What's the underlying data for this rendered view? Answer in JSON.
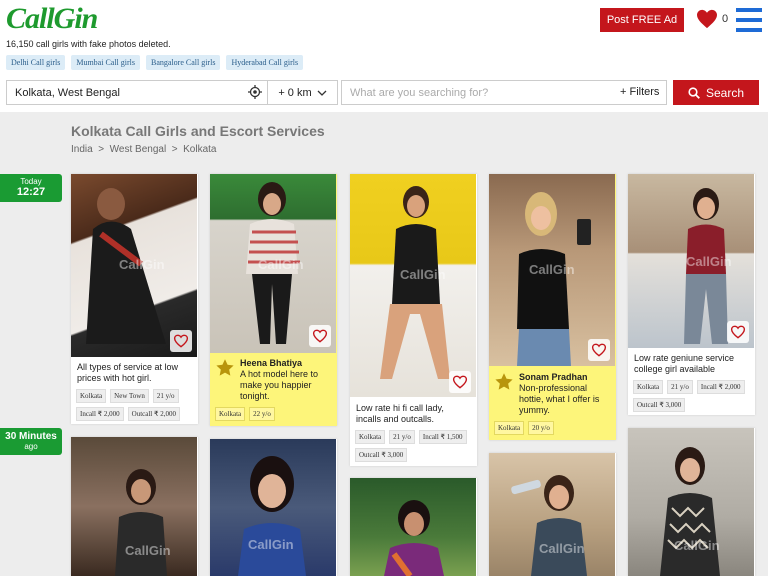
{
  "header": {
    "logo": "CallGin",
    "tagline": "16,150 call girls with fake photos deleted.",
    "chips": [
      "Delhi Call girls",
      "Mumbai Call girls",
      "Bangalore Call girls",
      "Hyderabad Call girls"
    ],
    "post_label": "Post FREE Ad",
    "fav_count": "0",
    "brand_color": "#1e9a2e",
    "accent_color": "#c4161c"
  },
  "search": {
    "location": "Kolkata, West Bengal",
    "radius": "+ 0 km",
    "placeholder": "What are you searching for?",
    "filters_label": "+ Filters",
    "button_label": "Search"
  },
  "page": {
    "title": "Kolkata Call Girls and Escort Services",
    "breadcrumb": [
      "India",
      "West Bengal",
      "Kolkata"
    ]
  },
  "time_groups": [
    {
      "line1": "Today",
      "line2": "12:27"
    },
    {
      "line1": "30 Minutes",
      "line2": "ago"
    }
  ],
  "listings": [
    {
      "featured": false,
      "name": "",
      "text": "All types of service at low prices with hot girl.",
      "tags": [
        "Kolkata",
        "New Town",
        "21 y/o",
        "Incall ₹ 2,000",
        "Outcall ₹ 2,000"
      ]
    },
    {
      "featured": true,
      "name": "Heena Bhatiya",
      "text": "A hot model here to make you happier tonight.",
      "tags": [
        "Kolkata",
        "22 y/o"
      ]
    },
    {
      "featured": false,
      "name": "",
      "text": "Low rate hi fi call lady, incalls and outcalls.",
      "tags": [
        "Kolkata",
        "21 y/o",
        "Incall ₹ 1,500",
        "Outcall ₹ 3,000"
      ]
    },
    {
      "featured": true,
      "name": "Sonam Pradhan",
      "text": "Non-professional hottie, what I offer is yummy.",
      "tags": [
        "Kolkata",
        "20 y/o"
      ]
    },
    {
      "featured": false,
      "name": "",
      "text": "Low rate geniune service college girl available",
      "tags": [
        "Kolkata",
        "21 y/o",
        "Incall ₹ 2,000",
        "Outcall ₹ 3,000"
      ]
    }
  ],
  "watermark": "CallGin"
}
